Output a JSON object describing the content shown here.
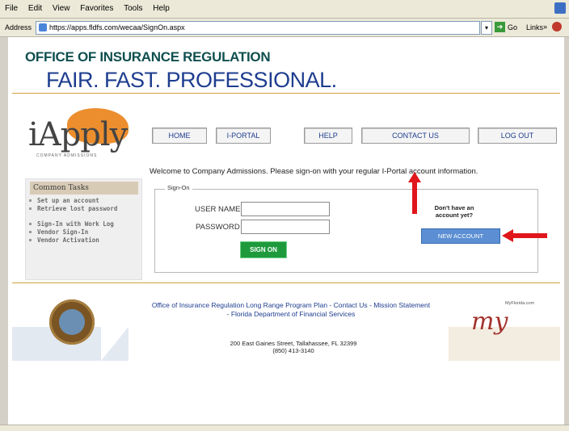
{
  "menubar": {
    "items": [
      "File",
      "Edit",
      "View",
      "Favorites",
      "Tools",
      "Help"
    ]
  },
  "addressbar": {
    "label": "Address",
    "url": "https://apps.fldfs.com/wecaa/SignOn.aspx",
    "go_label": "Go",
    "links_label": "Links"
  },
  "header": {
    "org": "OFFICE OF INSURANCE REGULATION",
    "tagline": "FAIR. FAST. PROFESSIONAL."
  },
  "logo": {
    "text": "iApply",
    "subtext": "COMPANY ADMISSIONS"
  },
  "nav": {
    "home": "HOME",
    "iportal": "I-PORTAL",
    "help": "HELP",
    "contact": "CONTACT US",
    "logout": "LOG OUT"
  },
  "welcome": "Welcome to Company Admissions. Please sign-on with your regular I-Portal account information.",
  "sidebar": {
    "title": "Common Tasks",
    "tasks": [
      "Set up an account",
      "Retrieve lost password",
      "Sign-In with Work Log",
      "Vendor Sign-In",
      "Vendor Activation"
    ]
  },
  "signon": {
    "legend": "Sign-On",
    "username_label": "USER NAME",
    "username_value": "",
    "password_label": "PASSWORD",
    "password_value": "",
    "submit": "SIGN ON",
    "no_account_text": "Don't have an account yet?",
    "new_account": "NEW ACCOUNT"
  },
  "footer": {
    "links_line1": "Office of Insurance Regulation Long Range Program Plan - Contact Us - Mission Statement",
    "links_line2": "- Florida Department of Financial Services",
    "address_line1": "200 East Gaines Street, Tallahassee, FL 32399",
    "address_line2": "(850) 413-3140",
    "my_logo_text": "my",
    "myflorida_text": "MyFlorida.com"
  },
  "colors": {
    "accent_gold": "#d3a23c",
    "brand_blue": "#1e3d8f",
    "signon_green": "#1e9a3c",
    "new_account_blue": "#5b8ed2",
    "arrow_red": "#e0161b"
  }
}
